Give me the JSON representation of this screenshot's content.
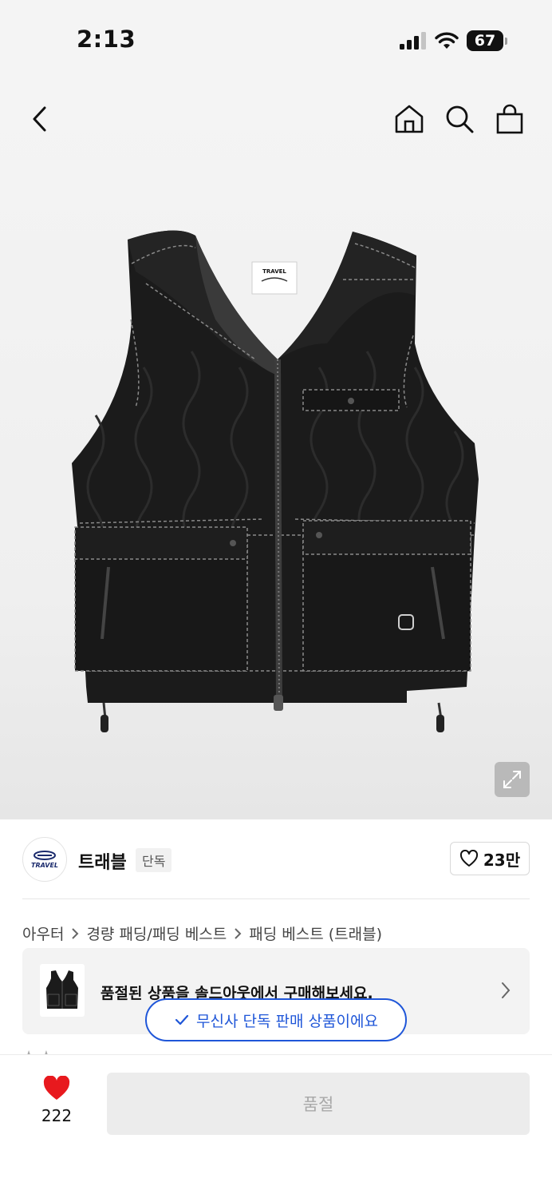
{
  "status_bar": {
    "time": "2:13",
    "battery": "67"
  },
  "nav": {
    "icons": [
      "back-icon",
      "home-icon",
      "search-icon",
      "shopping-bag-icon"
    ]
  },
  "product_image": {
    "label_text": "TRAVEL",
    "icon": "expand-icon"
  },
  "brand": {
    "name": "트래블",
    "badge": "단독",
    "logo_text": "TRAVEL",
    "likes": "23만"
  },
  "breadcrumb": {
    "items": [
      "아우터",
      "경량 패딩/패딩 베스트",
      "패딩 베스트 (트래블)"
    ]
  },
  "soldout_banner": {
    "text": "품절된 상품을 솔드아웃에서 구매해보세요."
  },
  "exclusive_pill": {
    "text": "무신사 단독 판매 상품이에요"
  },
  "bottom_bar": {
    "wish_count": "222",
    "action_label": "품절"
  },
  "colors": {
    "accent_blue": "#1f56d8",
    "heart_red": "#e8191e",
    "disabled_gray": "#ececec"
  }
}
